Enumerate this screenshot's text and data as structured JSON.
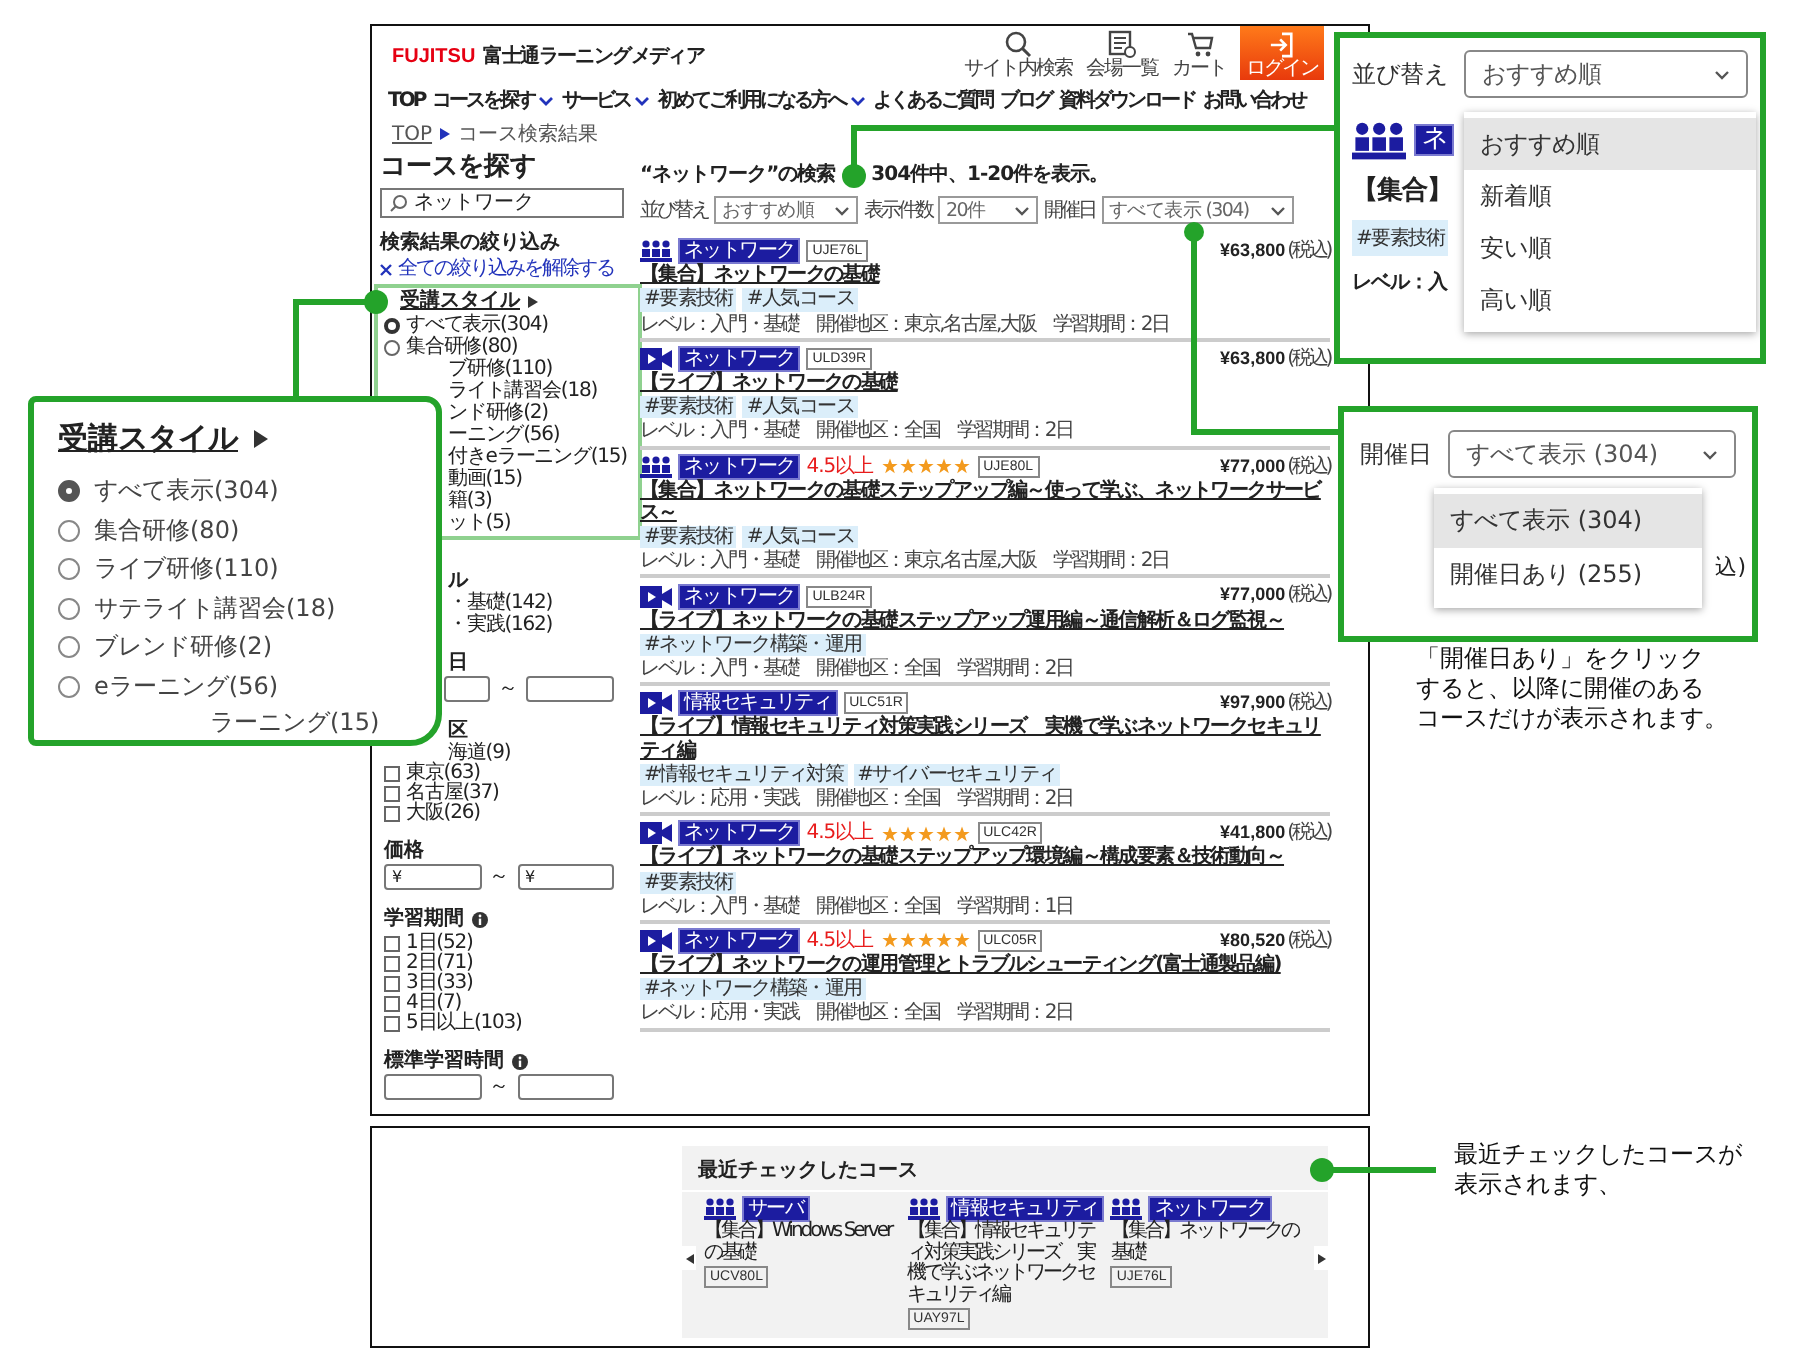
{
  "header": {
    "logo": "FUJITSU",
    "site_name": "富士通ラーニングメディア",
    "tools": [
      {
        "kind": "search",
        "label": "サイト内検索"
      },
      {
        "kind": "venues",
        "label": "会場一覧"
      },
      {
        "kind": "cart",
        "label": "カート"
      },
      {
        "kind": "login",
        "label": "ログイン"
      }
    ]
  },
  "nav": [
    {
      "label": "TOP",
      "dropdown": false
    },
    {
      "label": "コースを探す",
      "dropdown": true
    },
    {
      "label": "サービス",
      "dropdown": true
    },
    {
      "label": "初めてご利用になる方へ",
      "dropdown": true
    },
    {
      "label": "よくあるご質問",
      "dropdown": false
    },
    {
      "label": "ブログ",
      "dropdown": false
    },
    {
      "label": "資料ダウンロード",
      "dropdown": false
    },
    {
      "label": "お問い合わせ",
      "dropdown": false
    }
  ],
  "breadcrumb": [
    "TOP",
    "コース検索結果"
  ],
  "sidebar": {
    "title": "コースを探す",
    "search": {
      "value": "ネットワーク"
    },
    "filter_title": "検索結果の絞り込み",
    "clear_link": "全ての絞り込みを解除する",
    "sections": [
      {
        "kind": "radios",
        "title": "受講スタイル",
        "highlighted": true,
        "items": [
          {
            "label": "すべて表示(304)",
            "selected": true
          },
          {
            "label": "集合研修(80)",
            "selected": false
          },
          {
            "label": "ブ研修(110)"
          },
          {
            "label": "ライト講習会(18)"
          },
          {
            "label": "ンド研修(2)"
          },
          {
            "label": "ーニング(56)"
          },
          {
            "label": "付きeラーニング(15)"
          },
          {
            "label": "動画(15)"
          },
          {
            "label": "籍(3)"
          },
          {
            "label": "ット(5)"
          }
        ]
      },
      {
        "kind": "checks",
        "title": "ル",
        "title_cut": true,
        "items": [
          {
            "label": "・基礎(142)"
          },
          {
            "label": "・実践(162)"
          }
        ]
      },
      {
        "kind": "range",
        "title": "日",
        "title_cut": true,
        "cut": true,
        "separator": "～"
      },
      {
        "kind": "checks",
        "title": "区",
        "title_cut": true,
        "items": [
          {
            "label": "海道(9)"
          },
          {
            "label": "東京(63)",
            "checked": false
          },
          {
            "label": "名古屋(37)",
            "checked": false
          },
          {
            "label": "大阪(26)",
            "checked": false
          }
        ]
      },
      {
        "kind": "range",
        "title": "価格",
        "from": "¥",
        "to": "¥",
        "separator": "～"
      },
      {
        "kind": "checks",
        "title": "学習期間",
        "info": true,
        "items": [
          {
            "label": "1日(52)",
            "checked": false
          },
          {
            "label": "2日(71)",
            "checked": false
          },
          {
            "label": "3日(33)",
            "checked": false
          },
          {
            "label": "4日(7)",
            "checked": false
          },
          {
            "label": "5日以上(103)",
            "checked": false
          }
        ]
      },
      {
        "kind": "range",
        "title": "標準学習時間",
        "info": true,
        "separator": "～"
      }
    ]
  },
  "results": {
    "summary": [
      "“ネットワーク”の検索",
      "304件中、1-20件を表示。"
    ],
    "controls": [
      {
        "label": "並び替え",
        "value": "おすすめ順"
      },
      {
        "label": "表示件数",
        "value": "20件"
      },
      {
        "label": "開催日",
        "value": "すべて表示 (304)"
      }
    ],
    "courses": [
      {
        "kind": "group",
        "category": "ネットワーク",
        "code": "UJE76L",
        "price": "¥63,800",
        "tax": "(税込)",
        "title": "【集合】ネットワークの基礎",
        "tags": [
          "#要素技術",
          "#人気コース"
        ],
        "meta": "レベル：入門・基礎　開催地区：東京,名古屋,大阪　学習期間：2日"
      },
      {
        "kind": "live",
        "category": "ネットワーク",
        "code": "ULD39R",
        "price": "¥63,800",
        "tax": "(税込)",
        "title": "【ライブ】ネットワークの基礎",
        "tags": [
          "#要素技術",
          "#人気コース"
        ],
        "meta": "レベル：入門・基礎　開催地区：全国　学習期間：2日"
      },
      {
        "kind": "group",
        "category": "ネットワーク",
        "rating": "4.5以上",
        "stars": 5,
        "code": "UJE80L",
        "price": "¥77,000",
        "tax": "(税込)",
        "title": "【集合】ネットワークの基礎ステップアップ編～使って学ぶ、ネットワークサービス～",
        "tags": [
          "#要素技術",
          "#人気コース"
        ],
        "meta": "レベル：入門・基礎　開催地区：東京,名古屋,大阪　学習期間：2日"
      },
      {
        "kind": "live",
        "category": "ネットワーク",
        "code": "ULB24R",
        "price": "¥77,000",
        "tax": "(税込)",
        "title": "【ライブ】ネットワークの基礎ステップアップ運用編～通信解析＆ログ監視～",
        "tags": [
          "#ネットワーク構築・運用"
        ],
        "meta": "レベル：入門・基礎　開催地区：全国　学習期間：2日"
      },
      {
        "kind": "live",
        "category": "情報セキュリティ",
        "code": "ULC51R",
        "price": "¥97,900",
        "tax": "(税込)",
        "title": "【ライブ】情報セキュリティ対策実践シリーズ　実機で学ぶネットワークセキュリティ編",
        "tags": [
          "#情報セキュリティ対策",
          "#サイバーセキュリティ"
        ],
        "meta": "レベル：応用・実践　開催地区：全国　学習期間：2日"
      },
      {
        "kind": "live",
        "category": "ネットワーク",
        "rating": "4.5以上",
        "stars": 5,
        "code": "ULC42R",
        "price": "¥41,800",
        "tax": "(税込)",
        "title": "【ライブ】ネットワークの基礎ステップアップ環境編～構成要素＆技術動向～",
        "tags": [
          "#要素技術"
        ],
        "meta": "レベル：入門・基礎　開催地区：全国　学習期間：1日"
      },
      {
        "kind": "live",
        "category": "ネットワーク",
        "rating": "4.5以上",
        "stars": 5,
        "code": "ULC05R",
        "price": "¥80,520",
        "tax": "(税込)",
        "title": "【ライブ】ネットワークの運用管理とトラブルシューティング(富士通製品編)",
        "tags": [
          "#ネットワーク構築・運用"
        ],
        "meta": "レベル：応用・実践　開催地区：全国　学習期間：2日"
      }
    ]
  },
  "recent": {
    "title": "最近チェックしたコース",
    "courses": [
      {
        "kind": "group",
        "category": "サーバ",
        "title": "【集合】Windows Serverの基礎",
        "code": "UCV80L"
      },
      {
        "kind": "group",
        "category": "情報セキュリティ",
        "title": "【集合】情報セキュリティ対策実践シリーズ　実機で学ぶネットワークセキュリティ編",
        "code": "UAY97L"
      },
      {
        "kind": "group",
        "category": "ネットワーク",
        "title": "【集合】ネットワークの基礎",
        "code": "UJE76L"
      }
    ]
  },
  "zoom_sort": {
    "label": "並び替え",
    "value": "おすすめ順",
    "options": [
      {
        "label": "おすすめ順",
        "selected": true
      },
      {
        "label": "新着順",
        "selected": false
      },
      {
        "label": "安い順",
        "selected": false
      },
      {
        "label": "高い順",
        "selected": false
      }
    ],
    "behind": {
      "kind": "group",
      "category": "ネ",
      "title": "【集合】",
      "tag": "#要素技術",
      "meta": "レベル：入"
    }
  },
  "zoom_date": {
    "label": "開催日",
    "value": "すべて表示 (304)",
    "options": [
      {
        "label": "すべて表示 (304)",
        "selected": true
      },
      {
        "label": "開催日あり (255)",
        "selected": false
      }
    ],
    "behind": "込)"
  },
  "zoom_style": {
    "title": "受講スタイル",
    "options": [
      {
        "label": "すべて表示(304)",
        "selected": true
      },
      {
        "label": "集合研修(80)",
        "selected": false
      },
      {
        "label": "ライブ研修(110)",
        "selected": false
      },
      {
        "label": "サテライト講習会(18)",
        "selected": false
      },
      {
        "label": "ブレンド研修(2)",
        "selected": false
      },
      {
        "label": "eラーニング(56)",
        "selected": false
      }
    ],
    "cut_item": "ラーニング(15)"
  },
  "notes": [
    {
      "lines": [
        "「開催日あり」をクリック",
        "すると、以降に開催のある",
        "コースだけが表示されます。"
      ]
    },
    {
      "lines": [
        "最近チェックしたコースが",
        "表示されます、"
      ]
    }
  ]
}
